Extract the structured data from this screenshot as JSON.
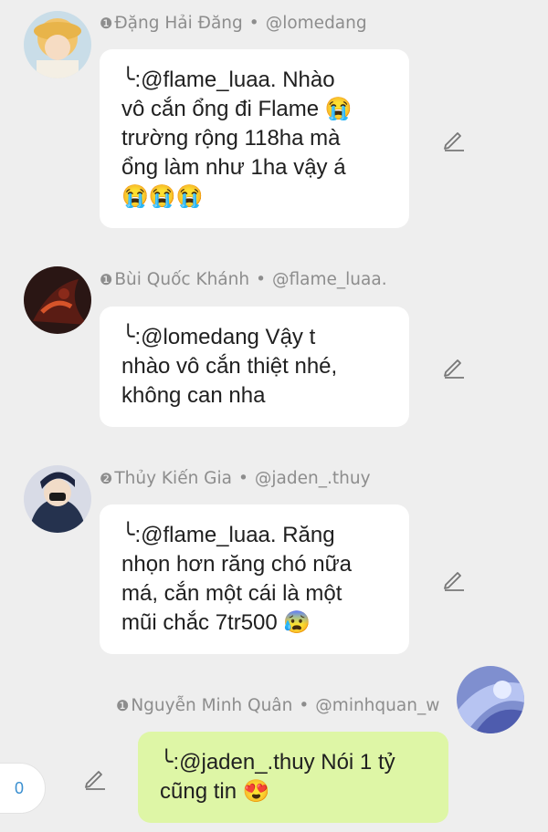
{
  "comments": [
    {
      "index": "❶",
      "author": "Đặng Hải Đăng",
      "handle": "@lomedang",
      "separator": "•",
      "lines": [
        "╰:@flame_luaa. Nhào",
        "vô cắn ổng đi Flame 😭",
        "trường rộng 118ha mà",
        "ổng làm như 1ha vậy á",
        "😭😭😭"
      ]
    },
    {
      "index": "❶",
      "author": "Bùi Quốc Khánh",
      "handle": "@flame_luaa.",
      "separator": "•",
      "lines": [
        "╰:@lomedang Vậy t",
        "nhào vô cắn thiệt nhé,",
        "không can nha"
      ]
    },
    {
      "index": "❷",
      "author": "Thủy Kiến Gia",
      "handle": "@jaden_.thuy",
      "separator": "•",
      "lines": [
        "╰:@flame_luaa. Răng",
        "nhọn hơn răng chó nữa",
        "má, cắn một cái là một",
        "mũi chắc 7tr500 😰"
      ]
    },
    {
      "index": "❶",
      "author": "Nguyễn Minh Quân",
      "handle": "@minhquan_w",
      "separator": "•",
      "lines": [
        "╰:@jaden_.thuy Nói 1 tỷ",
        "cũng tin 😍"
      ]
    }
  ],
  "counter": {
    "value": "0"
  },
  "icons": {
    "edit": "pencil-icon"
  },
  "colors": {
    "own_bubble": "#def6a6",
    "bubble": "#ffffff",
    "background": "#eeeeee",
    "meta": "#8d8d8d",
    "counter": "#3a8fd0"
  }
}
